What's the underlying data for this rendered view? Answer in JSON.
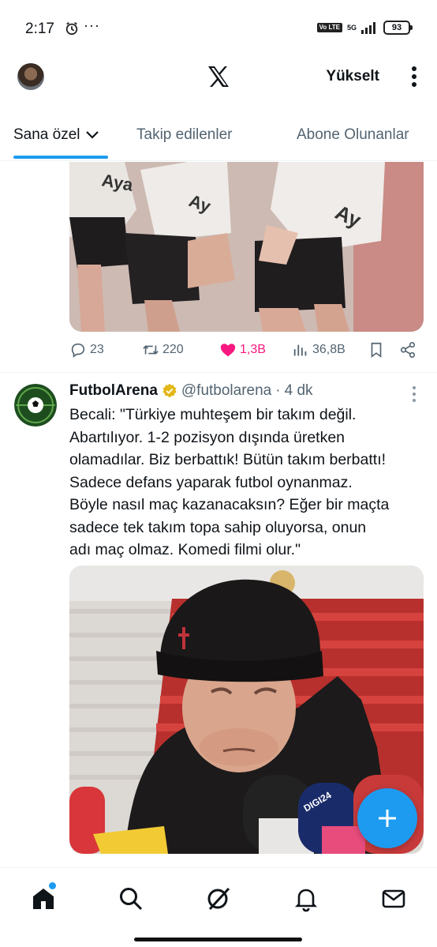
{
  "status_bar": {
    "time": "2:17",
    "more": "···",
    "volte": "Vo LTE",
    "network": "5G",
    "battery": "93"
  },
  "header": {
    "logo_icon": "x-logo-icon",
    "upgrade_label": "Yükselt"
  },
  "tabs": [
    {
      "label": "Sana özel",
      "active": true
    },
    {
      "label": "Takip edilenler",
      "active": false
    },
    {
      "label": "Abone Olunanlar",
      "active": false
    }
  ],
  "prev_tweet": {
    "replies": "23",
    "reposts": "220",
    "likes": "1,3B",
    "views": "36,8B"
  },
  "tweet": {
    "name": "FutbolArena",
    "handle": "@futbolarena",
    "separator": "·",
    "time": "4 dk",
    "text_lines": [
      "Becali: \"Türkiye muhteşem bir takım değil.",
      "Abartılıyor. 1-2 pozisyon dışında üretken",
      "olamadılar. Biz berbattık! Bütün takım berbattı!",
      "Sadece defans yaparak futbol oynanmaz.",
      "Böyle nasıl maç kazanacaksın? Eğer bir maçta",
      "sadece tek takım topa sahip oluyorsa, onun",
      "adı maç olmaz. Komedi filmi olur.\""
    ],
    "verified_color": "#e2b719"
  },
  "colors": {
    "accent": "#1d9bf0",
    "like": "#f91880",
    "muted": "#536471"
  },
  "bottom_nav": [
    "home-icon",
    "search-icon",
    "grok-icon",
    "notifications-icon",
    "messages-icon"
  ]
}
